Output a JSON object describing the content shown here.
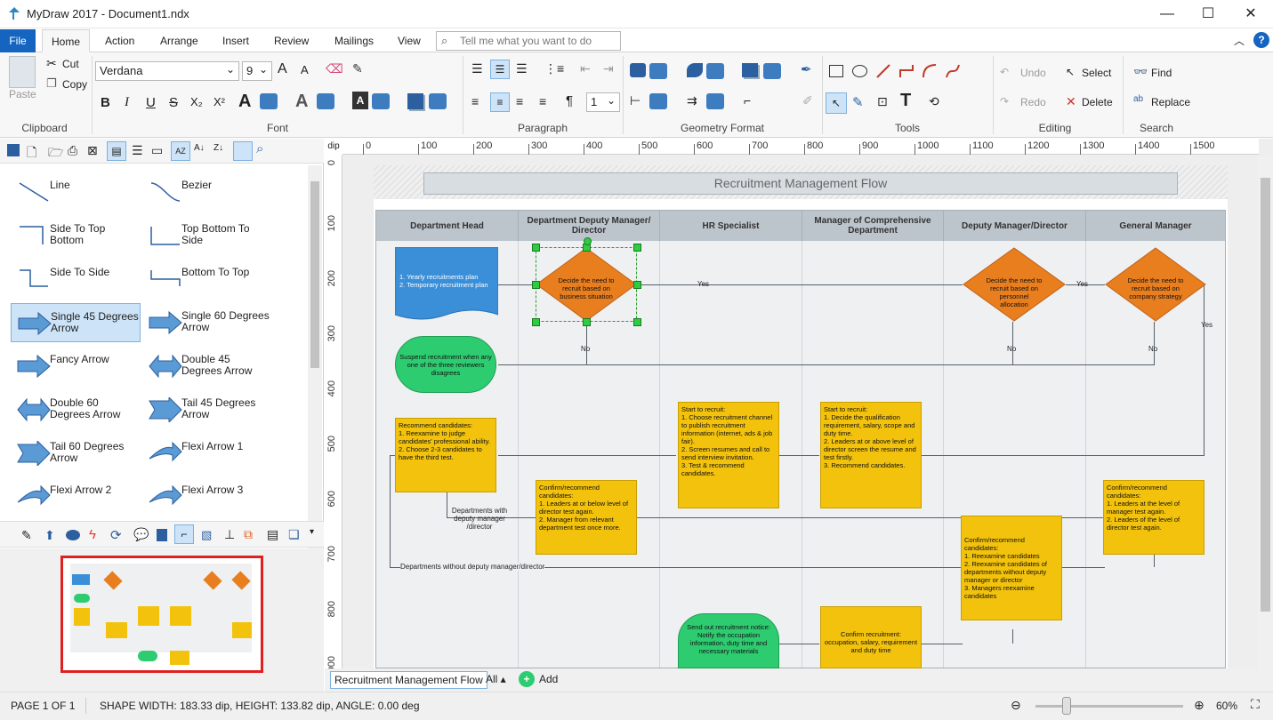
{
  "window": {
    "title": "MyDraw 2017 - Document1.ndx",
    "minimize": "—",
    "maximize": "☐",
    "close": "✕"
  },
  "tabs": [
    "File",
    "Home",
    "Action",
    "Arrange",
    "Insert",
    "Review",
    "Mailings",
    "View"
  ],
  "tell_me": "Tell me what you want to do",
  "ribbon": {
    "clipboard": {
      "label": "Clipboard",
      "paste": "Paste",
      "cut": "Cut",
      "copy": "Copy"
    },
    "font": {
      "label": "Font",
      "family": "Verdana",
      "size": "9"
    },
    "paragraph": {
      "label": "Paragraph",
      "spacing": "1"
    },
    "geometry": {
      "label": "Geometry Format"
    },
    "tools": {
      "label": "Tools"
    },
    "editing": {
      "label": "Editing",
      "undo": "Undo",
      "redo": "Redo",
      "select": "Select",
      "delete": "Delete"
    },
    "search": {
      "label": "Search",
      "find": "Find",
      "replace": "Replace"
    }
  },
  "shapes": [
    {
      "label": "Line"
    },
    {
      "label": "Bezier"
    },
    {
      "label": "Side To Top Bottom"
    },
    {
      "label": "Top Bottom To Side"
    },
    {
      "label": "Side To Side"
    },
    {
      "label": "Bottom To Top"
    },
    {
      "label": "Single 45 Degrees Arrow"
    },
    {
      "label": "Single 60 Degrees Arrow"
    },
    {
      "label": "Fancy Arrow"
    },
    {
      "label": "Double 45 Degrees Arrow"
    },
    {
      "label": "Double 60 Degrees Arrow"
    },
    {
      "label": "Tail 45 Degrees Arrow"
    },
    {
      "label": "Tail 60 Degrees Arrow"
    },
    {
      "label": "Flexi Arrow 1"
    },
    {
      "label": "Flexi Arrow 2"
    },
    {
      "label": "Flexi Arrow 3"
    }
  ],
  "ruler": {
    "unit": "dip",
    "h_ticks": [
      "0",
      "100",
      "200",
      "300",
      "400",
      "500",
      "600",
      "700",
      "800",
      "900",
      "1000",
      "1100",
      "1200",
      "1300",
      "1400",
      "1500"
    ],
    "v_ticks": [
      "0",
      "100",
      "200",
      "300",
      "400",
      "500",
      "600",
      "700",
      "800",
      "900"
    ]
  },
  "diagram": {
    "title": "Recruitment Management Flow",
    "lanes": [
      "Department Head",
      "Department Deputy Manager/ Director",
      "HR Specialist",
      "Manager of Comprehensive Department",
      "Deputy Manager/Director",
      "General Manager"
    ],
    "nodes": {
      "plan": "1. Yearly recruitments plan\n2. Temporary recruitment plan",
      "decide1": "Decide the need to recruit based on business situation",
      "decide2": "Decide the need to recruit based on personnel allocation",
      "decide3": "Decide the need to recruit based on company strategy",
      "suspend": "Suspend recruitment when any one of the three reviewers disagrees",
      "recommend": "Recommend candidates:\n1. Reexamine to judge candidates' professional ability.\n2. Choose 2-3 candidates to have the third test.",
      "start_hr": "Start to recruit:\n1. Choose recruitment channel to publish recruitment information (internet, ads & job fair).\n2. Screen resumes and call to send interview invitation.\n3. Test & recommend candidates.",
      "start_mgr": "Start to recruit:\n1. Decide the qualification requirement, salary, scope and duty time.\n2. Leaders at or above level of director screen the resume and test firstly.\n3. Recommend candidates.",
      "confirm_deputy": "Confirm/recommend candidates:\n1. Leaders at or below level of director test again.\n2. Manager from relevant department test once more.",
      "confirm_gm": "Confirm/recommend candidates:\n1. Leaders at the level of manager test again.\n2. Leaders of the level of director test again.",
      "confirm_dd": "Confirm/recommend candidates:\n1. Reexamine candidates\n2. Reexamine candidates of departments without deputy manager or director\n3. Managers reexamine candidates",
      "send_notice": "Send out recruitment notice:\nNotify the occupation information, duty time and necessary materials",
      "confirm_req": "Confirm recruitment: occupation, salary, requirement and duty time"
    },
    "labels": {
      "yes": "Yes",
      "no": "No",
      "with_deputy": "Departments with deputy manager /director",
      "without_deputy": "Departments without deputy manager/director"
    }
  },
  "page_tabs": {
    "current": "Recruitment Management Flow",
    "all": "All ▴",
    "add": "Add"
  },
  "status": {
    "page": "PAGE 1 OF 1",
    "shape": "SHAPE WIDTH: 183.33 dip, HEIGHT: 133.82 dip, ANGLE: 0.00 deg",
    "zoom": "60%"
  },
  "colors": {
    "accent": "#1565c0",
    "orange": "#e87e1e",
    "yellow": "#f2c20d",
    "green": "#2ecc71",
    "blue": "#3b8fd8",
    "lane_header": "#bcc4cc"
  }
}
